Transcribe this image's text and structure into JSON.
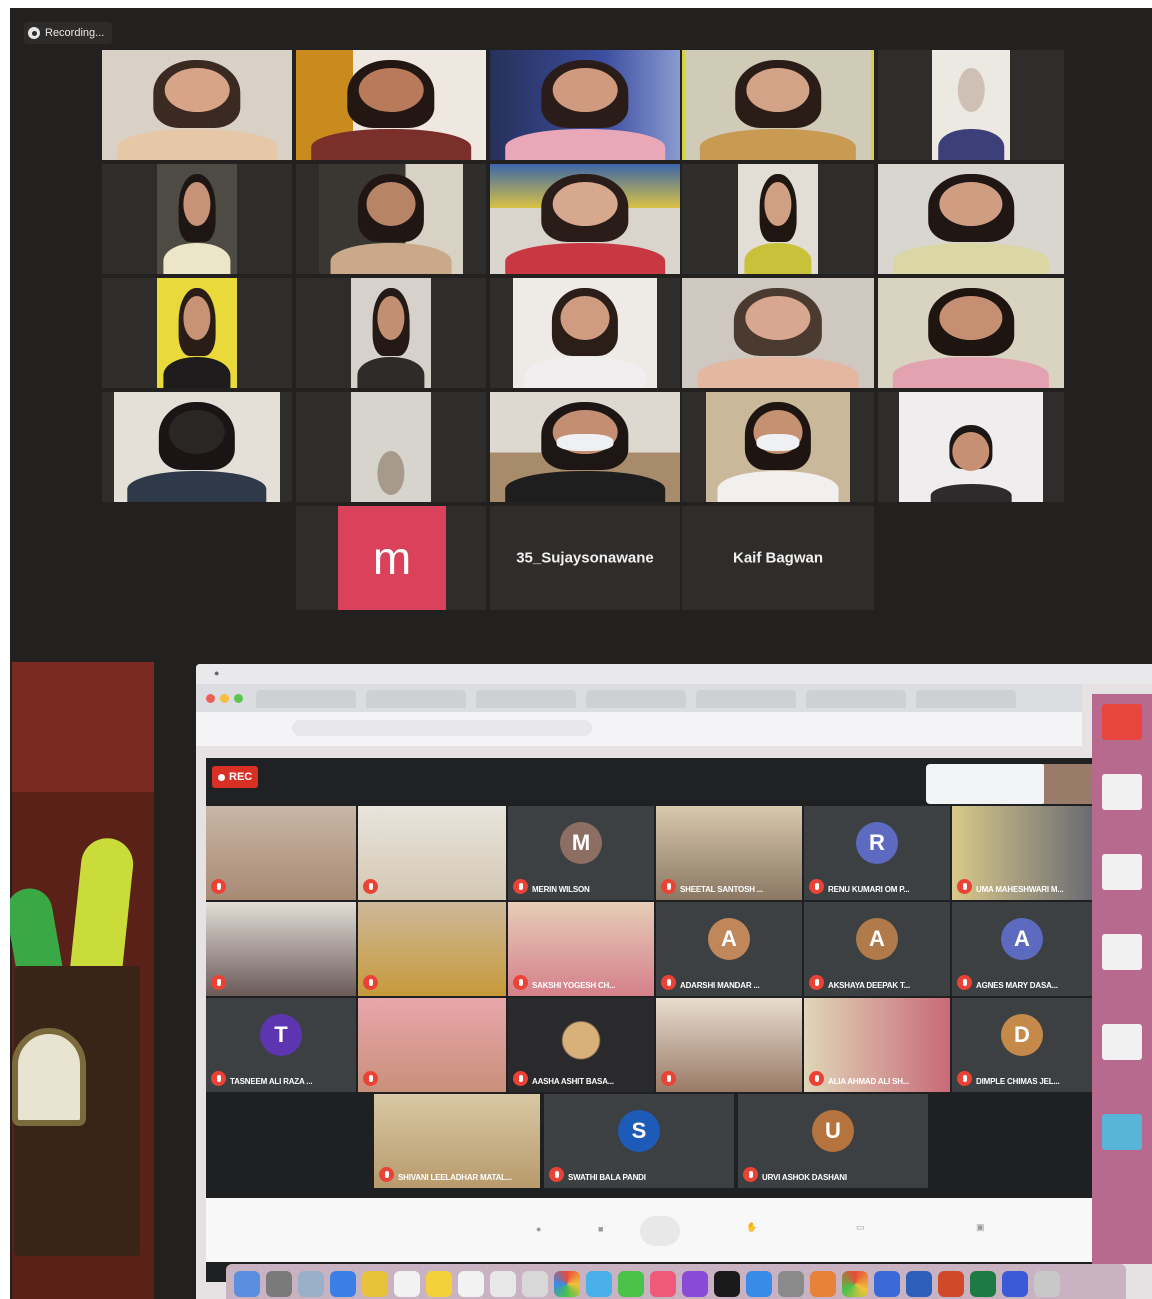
{
  "zoom": {
    "recording_label": "Recording...",
    "avatar_letter": "m",
    "name_tiles": [
      "35_Sujaysonawane",
      "Kaif Bagwan"
    ]
  },
  "meet": {
    "rec_label": "REC",
    "participants": [
      {
        "name": "",
        "initial": "",
        "color": ""
      },
      {
        "name": "",
        "initial": "",
        "color": ""
      },
      {
        "name": "MERIN WILSON",
        "initial": "M",
        "color": "#8d6e63"
      },
      {
        "name": "SHEETAL SANTOSH ...",
        "initial": "",
        "color": ""
      },
      {
        "name": "RENU KUMARI OM P...",
        "initial": "R",
        "color": "#5c6bc0"
      },
      {
        "name": "UMA MAHESHWARI M...",
        "initial": "",
        "color": ""
      },
      {
        "name": "",
        "initial": "",
        "color": ""
      },
      {
        "name": "",
        "initial": "",
        "color": ""
      },
      {
        "name": "SAKSHI YOGESH CH...",
        "initial": "",
        "color": ""
      },
      {
        "name": "ADARSHI MANDAR ...",
        "initial": "A",
        "color": "#c0875a"
      },
      {
        "name": "AKSHAYA DEEPAK T...",
        "initial": "A",
        "color": "#b07a4a"
      },
      {
        "name": "AGNES MARY DASA...",
        "initial": "A",
        "color": "#5c6bc0"
      },
      {
        "name": "TASNEEM ALI RAZA ...",
        "initial": "T",
        "color": "#5e35b1"
      },
      {
        "name": "",
        "initial": "",
        "color": ""
      },
      {
        "name": "AASHA ASHIT BASA...",
        "initial": "",
        "color": ""
      },
      {
        "name": "",
        "initial": "",
        "color": ""
      },
      {
        "name": "ALIA AHMAD ALI SH...",
        "initial": "",
        "color": ""
      },
      {
        "name": "DIMPLE CHIMAS JEL...",
        "initial": "D",
        "color": "#c58a4a"
      },
      {
        "name": "SHIVANI LEELADHAR MATAL...",
        "initial": "",
        "color": ""
      },
      {
        "name": "SWATHI BALA PANDI",
        "initial": "S",
        "color": "#1e5bb8"
      },
      {
        "name": "URVI ASHOK DASHANI",
        "initial": "U",
        "color": "#b5743e"
      }
    ]
  }
}
